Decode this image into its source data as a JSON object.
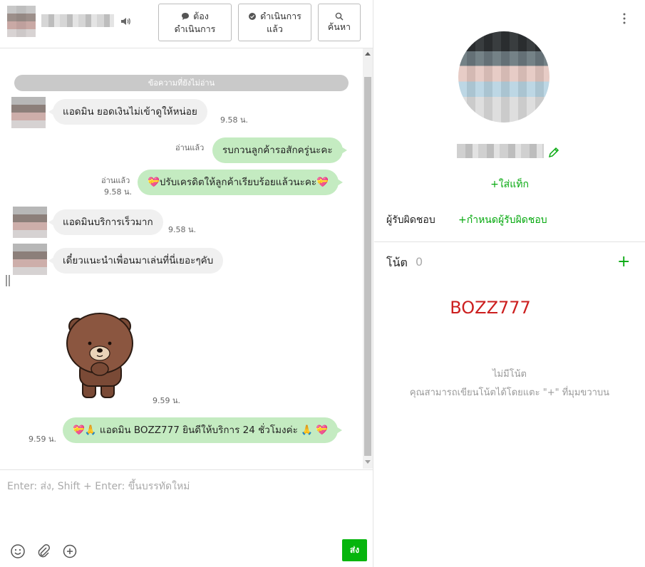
{
  "header": {
    "buttons": [
      {
        "line1": "ต้อง",
        "line2": "ดำเนินการ",
        "icon": "chat-bubble-icon"
      },
      {
        "line1": "ดำเนินการ",
        "line2": "แล้ว",
        "icon": "check-bubble-icon"
      },
      {
        "line1": "",
        "line2": "ค้นหา",
        "icon": "search-icon"
      }
    ]
  },
  "messages": {
    "unread_label": "ข้อความที่ยังไม่อ่าน",
    "items": [
      {
        "direction": "in",
        "text": "แอดมิน ยอดเงินไม่เข้าดูให้หน่อย",
        "time": "9.58 น."
      },
      {
        "direction": "out",
        "text": "รบกวนลูกค้ารอสักครู่นะคะ",
        "read": "อ่านแล้ว",
        "time": ""
      },
      {
        "direction": "out",
        "text": "💝ปรับเครดิตให้ลูกค้าเรียบร้อยแล้วนะคะ💝",
        "read": "อ่านแล้ว",
        "time": "9.58 น."
      },
      {
        "direction": "in",
        "text": "แอดมินบริการเร็วมาก",
        "time": "9.58 น."
      },
      {
        "direction": "in",
        "text": "เดี๋ยวแนะนำเพื่อนมาเล่นที่นี่เยอะๆคับ",
        "time": ""
      },
      {
        "direction": "in",
        "type": "sticker",
        "time": "9.59 น."
      },
      {
        "direction": "out",
        "text": "💝🙏 แอดมิน BOZZ777 ยินดีให้บริการ 24 ชั่วโมงค่ะ 🙏 💝",
        "time": "9.59 น."
      }
    ]
  },
  "composer": {
    "placeholder": "Enter: ส่ง, Shift + Enter: ขึ้นบรรทัดใหม่",
    "send_label": "ส่ง"
  },
  "profile": {
    "add_tag_label": "+ใส่แท็ก",
    "assignee_label": "ผู้รับผิดชอบ",
    "assignee_link": "+กำหนดผู้รับผิดชอบ",
    "notes_label": "โน้ต",
    "notes_count": "0",
    "notes_add": "+",
    "brand_text": "BOZZ777",
    "empty_title": "ไม่มีโน้ต",
    "empty_desc": "คุณสามารถเขียนโน้ตได้โดยแตะ \"+\" ที่มุมขวาบน"
  },
  "colors": {
    "accent_green": "#06b50d",
    "bubble_out": "#c4ebc1",
    "bubble_in": "#f0f0f0",
    "brand_red": "#cc1f1f"
  }
}
